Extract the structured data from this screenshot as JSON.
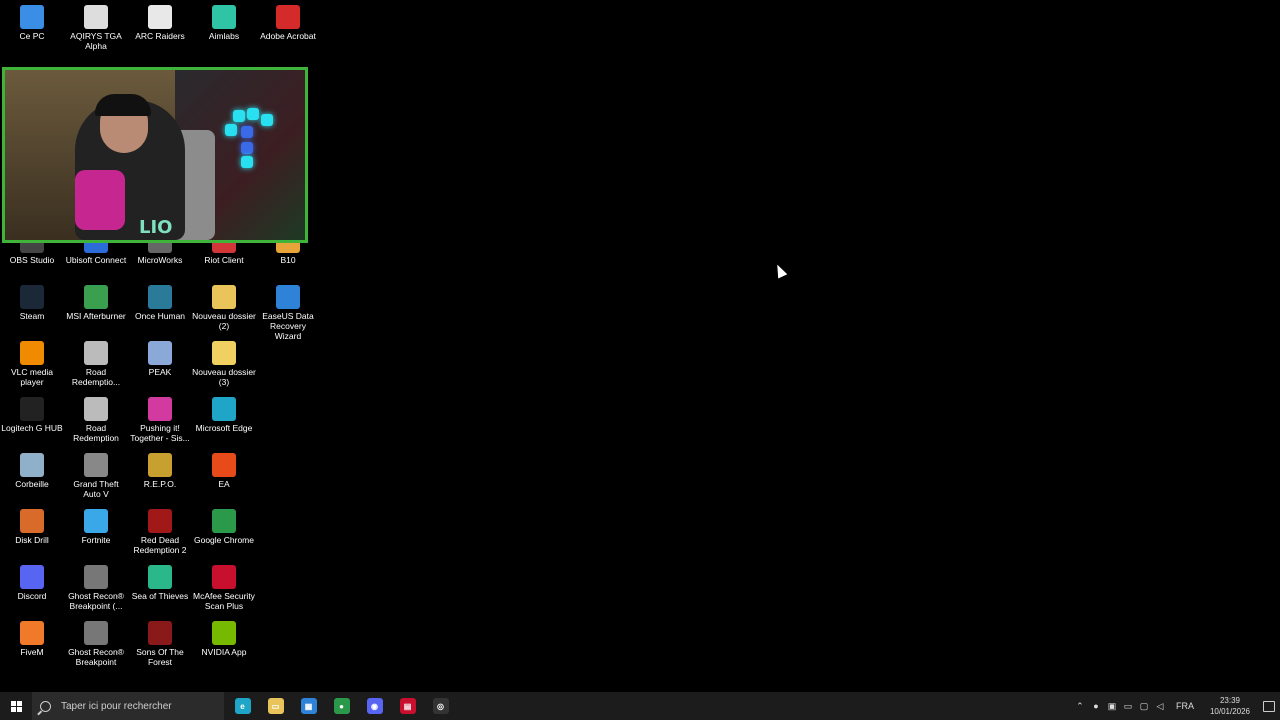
{
  "desktop": {
    "icons_row1": [
      {
        "label": "Ce PC",
        "icon": "computer-icon",
        "color": "#3a8ee6"
      },
      {
        "label": "AQIRYS TGA Alpha",
        "icon": "aqirys-icon",
        "color": "#dddddd"
      },
      {
        "label": "ARC Raiders",
        "icon": "file-icon",
        "color": "#e8e8e8"
      },
      {
        "label": "Aimlabs",
        "icon": "aimlabs-icon",
        "color": "#2ec4a5"
      },
      {
        "label": "Adobe Acrobat",
        "icon": "acrobat-icon",
        "color": "#d42a2a"
      }
    ],
    "icons_row3": [
      {
        "label": "OBS Studio",
        "icon": "obs-icon",
        "color": "#444444"
      },
      {
        "label": "Ubisoft Connect",
        "icon": "ubisoft-icon",
        "color": "#2b6cd8"
      },
      {
        "label": "MicroWorks",
        "icon": "microworks-icon",
        "color": "#666666"
      },
      {
        "label": "Riot Client",
        "icon": "riot-icon",
        "color": "#d13639"
      },
      {
        "label": "B10",
        "icon": "b10-icon",
        "color": "#e8a33a"
      }
    ],
    "icons_grid": [
      [
        {
          "label": "Steam",
          "icon": "steam-icon",
          "color": "#1b2838"
        },
        {
          "label": "MSI Afterburner",
          "icon": "afterburner-icon",
          "color": "#3aa050"
        },
        {
          "label": "Once Human",
          "icon": "oncehuman-icon",
          "color": "#2a7a9a"
        },
        {
          "label": "Nouveau dossier (2)",
          "icon": "folder-icon",
          "color": "#e8c45a"
        },
        {
          "label": "EaseUS Data Recovery Wizard",
          "icon": "easeus-icon",
          "color": "#2e82d8"
        }
      ],
      [
        {
          "label": "VLC media player",
          "icon": "vlc-icon",
          "color": "#f08a00"
        },
        {
          "label": "Road Redemptio...",
          "icon": "roadredemption-icon",
          "color": "#bbbbbb"
        },
        {
          "label": "PEAK",
          "icon": "peak-icon",
          "color": "#8aa8d8"
        },
        {
          "label": "Nouveau dossier (3)",
          "icon": "folder-icon",
          "color": "#f0d060"
        },
        null
      ],
      [
        {
          "label": "Logitech G HUB",
          "icon": "ghub-icon",
          "color": "#222222"
        },
        {
          "label": "Road Redemption",
          "icon": "roadredemption-icon",
          "color": "#bbbbbb"
        },
        {
          "label": "Pushing it! Together - Sis...",
          "icon": "pushingit-icon",
          "color": "#d23aa0"
        },
        {
          "label": "Microsoft Edge",
          "icon": "edge-icon",
          "color": "#1fa5c8"
        },
        null
      ],
      [
        {
          "label": "Corbeille",
          "icon": "recycle-bin-icon",
          "color": "#8fb0c8"
        },
        {
          "label": "Grand Theft Auto V",
          "icon": "gta-icon",
          "color": "#888888"
        },
        {
          "label": "R.E.P.O.",
          "icon": "repo-icon",
          "color": "#c8a030"
        },
        {
          "label": "EA",
          "icon": "ea-icon",
          "color": "#e84a1a"
        },
        null
      ],
      [
        {
          "label": "Disk Drill",
          "icon": "diskdrill-icon",
          "color": "#d86a2a"
        },
        {
          "label": "Fortnite",
          "icon": "fortnite-icon",
          "color": "#3aa8e8"
        },
        {
          "label": "Red Dead Redemption 2",
          "icon": "rdr2-icon",
          "color": "#a01818"
        },
        {
          "label": "Google Chrome",
          "icon": "chrome-icon",
          "color": "#2a9a4a"
        },
        null
      ],
      [
        {
          "label": "Discord",
          "icon": "discord-icon",
          "color": "#5865f2"
        },
        {
          "label": "Ghost Recon® Breakpoint (...",
          "icon": "ghostrecon-icon",
          "color": "#777777"
        },
        {
          "label": "Sea of Thieves",
          "icon": "seaofthieves-icon",
          "color": "#2ab88a"
        },
        {
          "label": "McAfee Security Scan Plus",
          "icon": "mcafee-icon",
          "color": "#c8102e"
        },
        null
      ],
      [
        {
          "label": "FiveM",
          "icon": "fivem-icon",
          "color": "#f07a2a"
        },
        {
          "label": "Ghost Recon® Breakpoint",
          "icon": "ghostrecon-icon",
          "color": "#777777"
        },
        {
          "label": "Sons Of The Forest",
          "icon": "sonsforest-icon",
          "color": "#8a1a1a"
        },
        {
          "label": "NVIDIA App",
          "icon": "nvidia-icon",
          "color": "#76b900"
        },
        null
      ]
    ]
  },
  "webcam": {
    "overlay_text": "LIO",
    "border_color": "#3fb43a"
  },
  "taskbar": {
    "search_placeholder": "Taper ici pour rechercher",
    "pinned": [
      {
        "name": "edge-icon",
        "color": "#1fa5c8",
        "glyph": "e"
      },
      {
        "name": "file-explorer-icon",
        "color": "#e8c45a",
        "glyph": "▭"
      },
      {
        "name": "store-icon",
        "color": "#2e82d8",
        "glyph": "▦"
      },
      {
        "name": "chrome-icon",
        "color": "#2a9a4a",
        "glyph": "●"
      },
      {
        "name": "discord-icon",
        "color": "#5865f2",
        "glyph": "◉"
      },
      {
        "name": "voicemeeter-icon",
        "color": "#c8102e",
        "glyph": "▤"
      },
      {
        "name": "app-icon",
        "color": "#333333",
        "glyph": "◎"
      }
    ],
    "tray": {
      "language": "FRA",
      "time": "23:39",
      "date": "10/01/2026"
    }
  }
}
